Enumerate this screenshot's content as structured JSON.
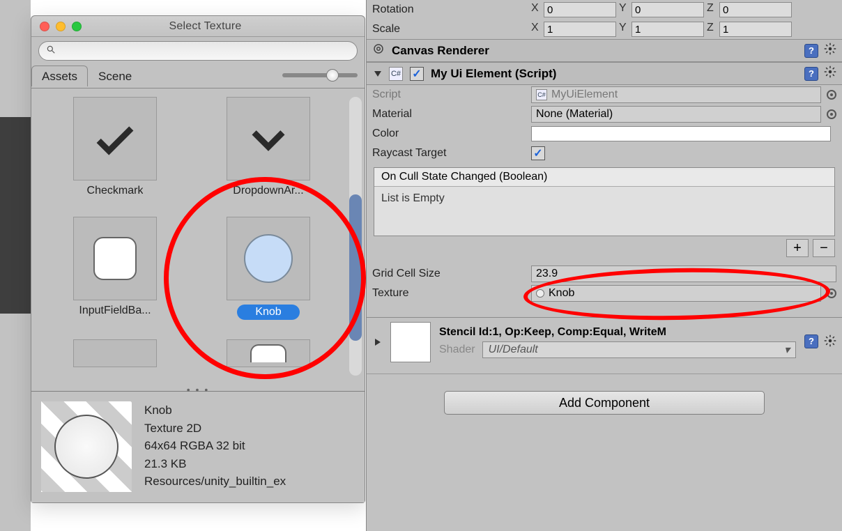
{
  "picker": {
    "title": "Select Texture",
    "search_placeholder": "",
    "tabs": {
      "assets": "Assets",
      "scene": "Scene"
    },
    "items": [
      {
        "label": "Checkmark"
      },
      {
        "label": "DropdownAr..."
      },
      {
        "label": "InputFieldBa..."
      },
      {
        "label": "Knob",
        "selected": true
      }
    ],
    "preview": {
      "name": "Knob",
      "type": "Texture 2D",
      "dims": "64x64  RGBA 32 bit",
      "size": "21.3 KB",
      "path": "Resources/unity_builtin_ex"
    }
  },
  "inspector": {
    "transform": {
      "rotation_label": "Rotation",
      "scale_label": "Scale",
      "axes": {
        "x": "X",
        "y": "Y",
        "z": "Z"
      },
      "rotation": {
        "x": "0",
        "y": "0",
        "z": "0"
      },
      "scale": {
        "x": "1",
        "y": "1",
        "z": "1"
      }
    },
    "canvas_renderer": {
      "title": "Canvas Renderer"
    },
    "script_component": {
      "title": "My Ui Element (Script)",
      "fields": {
        "script_label": "Script",
        "script_value": "MyUiElement",
        "material_label": "Material",
        "material_value": "None (Material)",
        "color_label": "Color",
        "raycast_label": "Raycast Target",
        "cull_header": "On Cull State Changed (Boolean)",
        "list_empty": "List is Empty",
        "grid_label": "Grid Cell Size",
        "grid_value": "23.9",
        "texture_label": "Texture",
        "texture_value": "Knob"
      }
    },
    "material_band": {
      "stencil": "Stencil Id:1, Op:Keep, Comp:Equal, WriteM",
      "shader_label": "Shader",
      "shader_value": "UI/Default"
    },
    "add_component": "Add Component"
  }
}
